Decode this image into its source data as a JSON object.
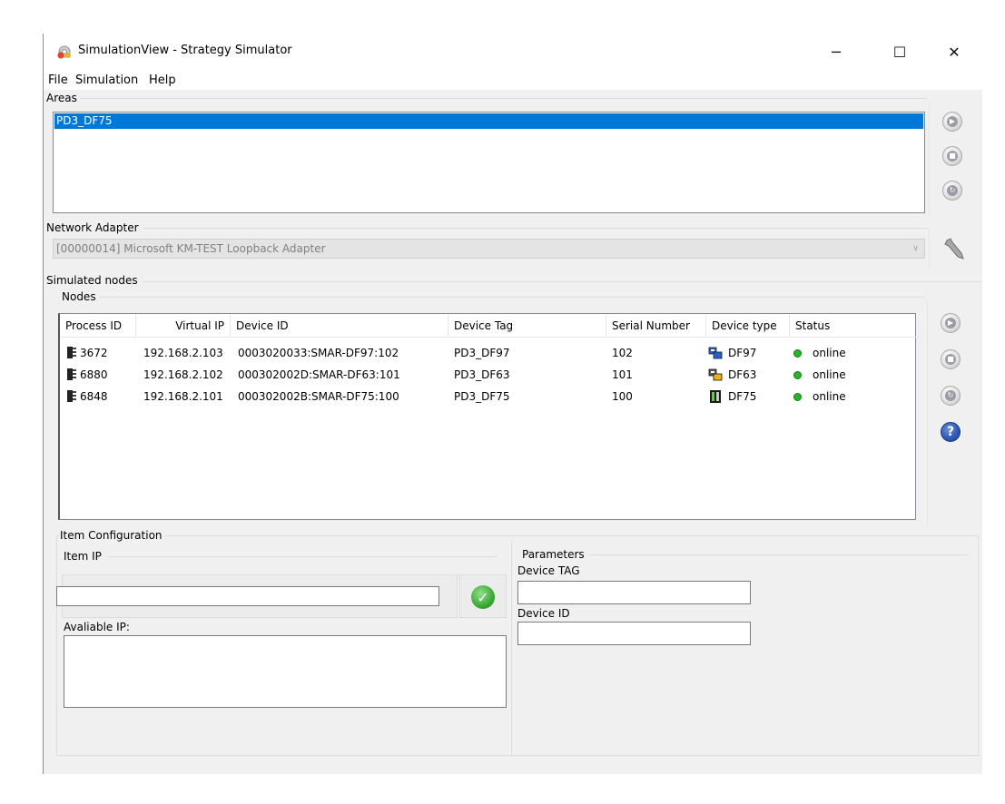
{
  "window": {
    "title": "SimulationView - Strategy Simulator",
    "controls": {
      "minimize": "─",
      "maximize": "☐",
      "close": "✕"
    }
  },
  "menu": {
    "items": [
      "File",
      "Simulation",
      "Help"
    ]
  },
  "areas": {
    "label": "Areas",
    "items": [
      "PD3_DF75"
    ],
    "selected_index": 0,
    "buttons": [
      "play-icon",
      "stop-icon",
      "restart-icon"
    ]
  },
  "network_adapter": {
    "label": "Network Adapter",
    "value": "[00000014] Microsoft KM-TEST Loopback Adapter",
    "tool_icon": "wrench-icon"
  },
  "simulated_nodes": {
    "label": "Simulated nodes",
    "nodes_label": "Nodes",
    "columns": [
      "Process ID",
      "Virtual IP",
      "Device ID",
      "Device Tag",
      "Serial Number",
      "Device type",
      "Status"
    ],
    "rows": [
      {
        "process_id": "3672",
        "virtual_ip": "192.168.2.103",
        "device_id": "0003020033:SMAR-DF97:102",
        "device_tag": "PD3_DF97",
        "serial": "102",
        "device_type": "DF97",
        "status": "online",
        "type_icon": "df97-icon"
      },
      {
        "process_id": "6880",
        "virtual_ip": "192.168.2.102",
        "device_id": "000302002D:SMAR-DF63:101",
        "device_tag": "PD3_DF63",
        "serial": "101",
        "device_type": "DF63",
        "status": "online",
        "type_icon": "df63-icon"
      },
      {
        "process_id": "6848",
        "virtual_ip": "192.168.2.101",
        "device_id": "000302002B:SMAR-DF75:100",
        "device_tag": "PD3_DF75",
        "serial": "100",
        "device_type": "DF75",
        "status": "online",
        "type_icon": "df75-icon"
      }
    ],
    "buttons": [
      "play-icon",
      "stop-icon",
      "restart-icon",
      "help-icon"
    ],
    "status_color": "#28b428"
  },
  "item_configuration": {
    "label": "Item Configuration",
    "item_ip_label": "Item IP",
    "ip_value": "",
    "available_ip_label": "Avaliable IP:",
    "parameters_label": "Parameters",
    "device_tag_label": "Device TAG",
    "device_tag_value": "",
    "device_id_label": "Device ID",
    "device_id_value": ""
  },
  "colors": {
    "selection": "#0078d7",
    "online": "#28b428",
    "help_button": "#2e57b2"
  }
}
